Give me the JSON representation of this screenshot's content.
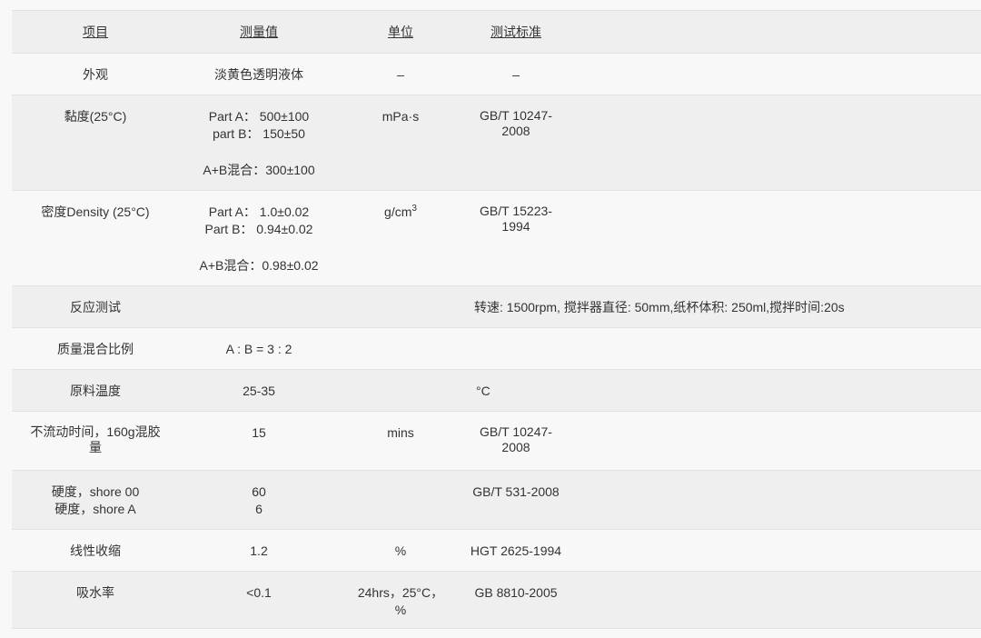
{
  "headers": [
    "项目",
    "测量值",
    "单位",
    "测试标准"
  ],
  "rows": {
    "appearance": {
      "item": "外观",
      "value": "淡黄色透明液体",
      "unit": "–",
      "standard": "–"
    },
    "viscosity": {
      "item": "黏度(25°C)",
      "value_a": "Part A： 500±100",
      "value_b": "part B： 150±50",
      "value_mix": "A+B混合：300±100",
      "unit": "mPa·s",
      "standard_1": "GB/T 10247-",
      "standard_2": "2008"
    },
    "density": {
      "item": "密度Density (25°C)",
      "value_a": "Part A： 1.0±0.02",
      "value_b": "Part B： 0.94±0.02",
      "value_mix": "A+B混合：0.98±0.02",
      "unit_base": "g/cm",
      "unit_sup": "3",
      "standard_1": "GB/T 15223-",
      "standard_2": "1994"
    },
    "reaction": {
      "item": "反应测试",
      "note": "转速: 1500rpm, 搅拌器直径: 50mm,纸杯体积: 250ml,搅拌时间:20s"
    },
    "mix_ratio": {
      "item": "质量混合比例",
      "value": "A : B = 3 : 2"
    },
    "material_temp": {
      "item": "原料温度",
      "value": "25-35",
      "unit": "°C"
    },
    "no_flow_time": {
      "item_1": "不流动时间，160g混胶",
      "item_2": "量",
      "value": "15",
      "unit": "mins",
      "standard_1": "GB/T 10247-",
      "standard_2": "2008"
    },
    "hardness": {
      "item_1": "硬度，shore 00",
      "item_2": "硬度，shore A",
      "value_1": "60",
      "value_2": "6",
      "standard": "GB/T 531-2008"
    },
    "linear_shrinkage": {
      "item": "线性收缩",
      "value": "1.2",
      "unit": "%",
      "standard": "HGT 2625-1994"
    },
    "water_absorption": {
      "item": "吸水率",
      "value": "<0.1",
      "unit_1": "24hrs，25°C，",
      "unit_2": "%",
      "standard": "GB 8810-2005"
    }
  }
}
